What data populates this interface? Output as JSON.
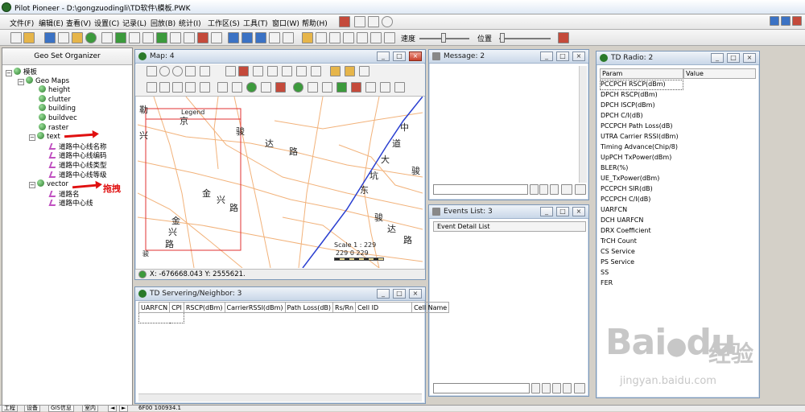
{
  "app": {
    "title": "Pilot Pioneer - D:\\gongzuodingli\\TD软件\\模板.PWK"
  },
  "menu": [
    "文件(F)",
    "编辑(E)",
    "查看(V)",
    "设置(C)",
    "记录(L)",
    "回放(B)",
    "统计(I)",
    "工作区(S)",
    "工具(T)",
    "窗口(W)",
    "帮助(H)"
  ],
  "toolbar": {
    "speed_label": "速度",
    "position_label": "位置"
  },
  "organizer": {
    "title": "Geo Set Organizer",
    "tree": {
      "root": "模板",
      "geo_maps": "Geo Maps",
      "items": [
        "height",
        "clutter",
        "building",
        "buildvec",
        "raster",
        "text"
      ],
      "text_children": [
        "道路中心线名称",
        "道路中心线编码",
        "道路中心线类型",
        "道路中心线等级"
      ],
      "vector": "vector",
      "vector_children": [
        "道路名",
        "道路中心线"
      ]
    },
    "annotation": "拖拽"
  },
  "map": {
    "title": "Map: 4",
    "legend": "Legend",
    "labels": [
      "勒",
      "京",
      "骏",
      "达",
      "路",
      "中",
      "兴",
      "道",
      "大",
      "坑",
      "东",
      "骏",
      "金",
      "兴",
      "路",
      "金",
      "兴",
      "路",
      "骏",
      "达",
      "路",
      "骏"
    ],
    "scale_text": "Scale  1   :  229",
    "scale_values": "229   0     229",
    "coords": "X: -676668.043 Y: 2555621."
  },
  "message": {
    "title": "Message: 2"
  },
  "events": {
    "title": "Events List: 3",
    "column": "Event Detail List"
  },
  "radio": {
    "title": "TD Radio: 2",
    "columns": [
      "Param",
      "Value"
    ],
    "params": [
      "PCCPCH RSCP(dBm)",
      "DPCH RSCP(dBm)",
      "DPCH ISCP(dBm)",
      "DPCH C/I(dB)",
      "PCCPCH Path Loss(dB)",
      "UTRA Carrier RSSI(dBm)",
      "Timing Advance(Chip/8)",
      "UpPCH TxPower(dBm)",
      "BLER(%)",
      "UE_TxPower(dBm)",
      "PCCPCH SIR(dB)",
      "PCCPCH C/I(dB)",
      "UARFCN",
      "DCH UARFCN",
      "DRX Coefficient",
      "TrCH Count",
      "CS Service",
      "PS Service",
      "SS",
      "FER"
    ]
  },
  "serving": {
    "title": "TD Servering/Neighbor: 3",
    "columns": [
      "UARFCN",
      "CPI",
      "RSCP(dBm)",
      "CarrierRSSI(dBm)",
      "Path Loss(dB)",
      "Rs/Rn",
      "Cell ID",
      "Cell Name"
    ]
  },
  "bottom_tabs": [
    "工程",
    "设备",
    "GIS信息",
    "室内"
  ],
  "status": {
    "text": "6F00 100934.1"
  },
  "watermark": {
    "brand": "Bai",
    "brand2": "du",
    "cn": "经验",
    "url": "jingyan.baidu.com"
  },
  "colors": {
    "road": "#f2b27a",
    "route": "#2a3fd0",
    "legend_box": "#e03030",
    "arrow": "#e01010"
  }
}
